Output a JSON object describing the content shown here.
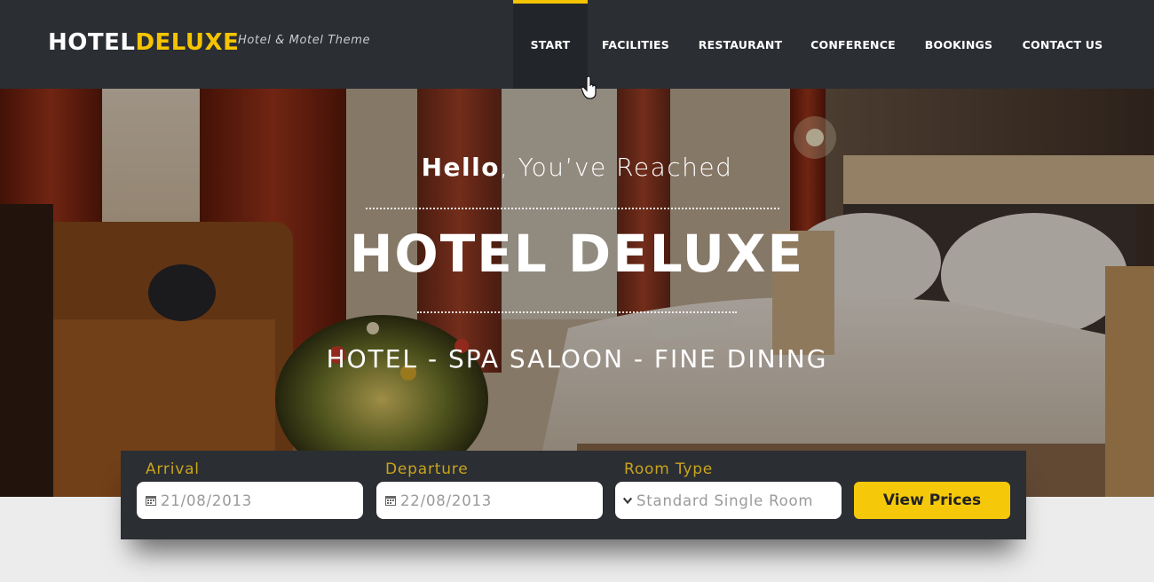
{
  "header": {
    "logo_part1": "HOTEL",
    "logo_part2": "DELUXE",
    "tagline": "Hotel & Motel Theme",
    "nav": [
      {
        "label": "START",
        "active": true
      },
      {
        "label": "FACILITIES",
        "active": false
      },
      {
        "label": "RESTAURANT",
        "active": false
      },
      {
        "label": "CONFERENCE",
        "active": false
      },
      {
        "label": "BOOKINGS",
        "active": false
      },
      {
        "label": "CONTACT US",
        "active": false
      }
    ]
  },
  "hero": {
    "hello_bold": "Hello",
    "hello_rest": ", You’ve Reached",
    "title": "HOTEL DELUXE",
    "subtitle": "HOTEL - SPA SALOON - FINE DINING"
  },
  "booking": {
    "arrival_label": "Arrival",
    "arrival_value": "21/08/2013",
    "departure_label": "Departure",
    "departure_value": "22/08/2013",
    "room_label": "Room Type",
    "room_value": "Standard Single Room",
    "button_label": "View Prices"
  },
  "icons": {
    "arrival": "calendar-icon",
    "departure": "calendar-icon",
    "room": "chevron-down-icon",
    "cursor": "hand-pointer-icon"
  },
  "colors": {
    "accent": "#f5c400",
    "header_bg": "#2b2e33",
    "label_gold": "#c9a41c"
  }
}
